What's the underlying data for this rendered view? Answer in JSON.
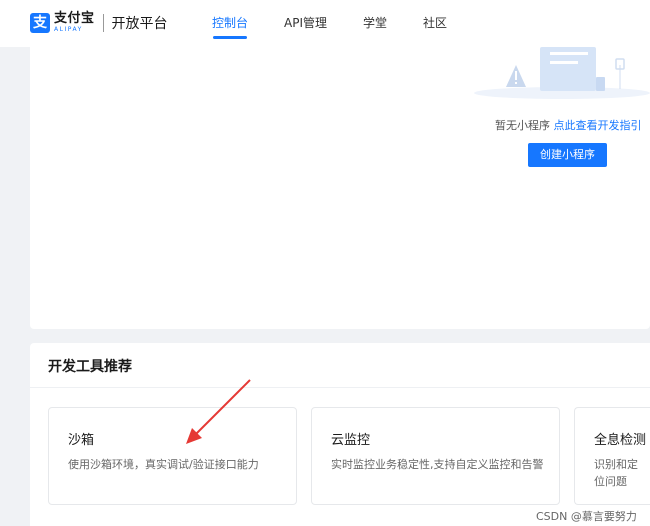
{
  "brand": {
    "logo_glyph": "支",
    "name_cn": "支付宝",
    "name_en": "ALIPAY",
    "platform": "开放平台"
  },
  "nav": [
    {
      "label": "控制台",
      "active": true
    },
    {
      "label": "API管理",
      "active": false
    },
    {
      "label": "学堂",
      "active": false
    },
    {
      "label": "社区",
      "active": false
    }
  ],
  "empty_state": {
    "text": "暂无小程序",
    "link": "点此查看开发指引",
    "button": "创建小程序"
  },
  "tools_section": {
    "title": "开发工具推荐",
    "tools": [
      {
        "name": "沙箱",
        "desc": "使用沙箱环境，真实调试/验证接口能力"
      },
      {
        "name": "云监控",
        "desc": "实时监控业务稳定性,支持自定义监控和告警"
      },
      {
        "name": "全息检测",
        "desc": "识别和定位问题"
      }
    ]
  },
  "watermark": "CSDN @慕言要努力",
  "colors": {
    "accent": "#1677ff",
    "annotation_arrow": "#e53935",
    "page_bg": "#f0f2f5"
  },
  "icons": [
    "alipay-logo-icon",
    "empty-illustration-icon",
    "annotation-arrow-icon"
  ]
}
